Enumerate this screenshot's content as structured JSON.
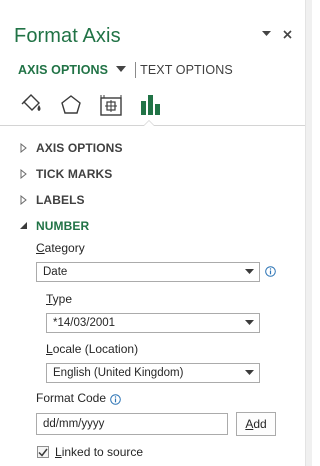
{
  "pane": {
    "title": "Format Axis",
    "tabs": {
      "active": "AXIS OPTIONS",
      "inactive": "TEXT OPTIONS"
    },
    "category_icons": [
      "fill-line-icon",
      "effects-pentagon-icon",
      "size-properties-icon",
      "axis-options-bar-chart-icon"
    ],
    "accent_color": "#217346"
  },
  "sections": {
    "axis_options": "AXIS OPTIONS",
    "tick_marks": "TICK MARKS",
    "labels": "LABELS",
    "number": "NUMBER"
  },
  "number": {
    "category_label": "Category",
    "category_value": "Date",
    "type_label": "Type",
    "type_value": "*14/03/2001",
    "locale_label": "Locale (Location)",
    "locale_value": "English (United Kingdom)",
    "format_code_label": "Format Code",
    "format_code_value": "dd/mm/yyyy",
    "add_label": "Add",
    "linked_label": "Linked to source",
    "linked_checked": true
  }
}
